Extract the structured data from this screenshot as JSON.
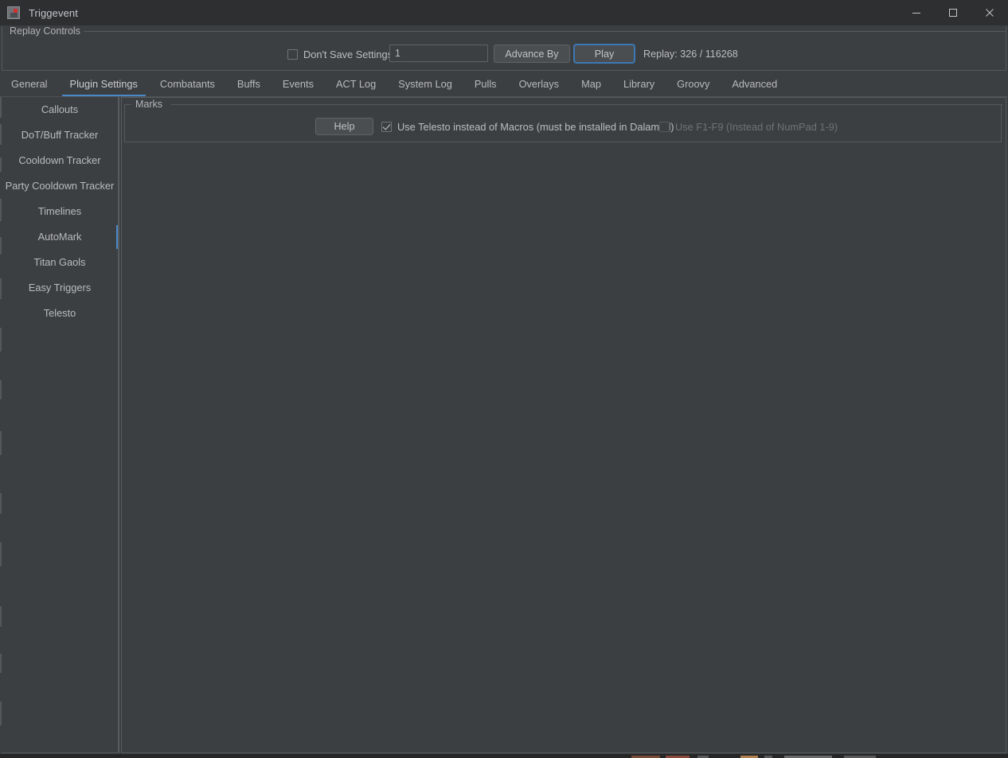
{
  "window": {
    "title": "Triggevent",
    "icon": "app-icon",
    "controls": {
      "minimize": "minimize-icon",
      "maximize": "maximize-icon",
      "close": "close-icon"
    }
  },
  "replay_controls": {
    "legend": "Replay Controls",
    "dont_save_label": "Don't Save Settings",
    "dont_save_checked": false,
    "advance_value": "1",
    "advance_placeholder": "",
    "advance_button": "Advance By",
    "play_button": "Play",
    "status": "Replay: 326 / 116268",
    "status_current": "326",
    "status_total": "116268"
  },
  "tabs": {
    "active": "Plugin Settings",
    "items": [
      {
        "label": "General"
      },
      {
        "label": "Plugin Settings"
      },
      {
        "label": "Combatants"
      },
      {
        "label": "Buffs"
      },
      {
        "label": "Events"
      },
      {
        "label": "ACT Log"
      },
      {
        "label": "System Log"
      },
      {
        "label": "Pulls"
      },
      {
        "label": "Overlays"
      },
      {
        "label": "Map"
      },
      {
        "label": "Library"
      },
      {
        "label": "Groovy"
      },
      {
        "label": "Advanced"
      }
    ]
  },
  "sidebar": {
    "selected": "AutoMark",
    "items": [
      {
        "label": "Callouts"
      },
      {
        "label": "DoT/Buff Tracker"
      },
      {
        "label": "Cooldown Tracker"
      },
      {
        "label": "Party Cooldown Tracker"
      },
      {
        "label": "Timelines"
      },
      {
        "label": "AutoMark"
      },
      {
        "label": "Titan Gaols"
      },
      {
        "label": "Easy Triggers"
      },
      {
        "label": "Telesto"
      }
    ]
  },
  "main": {
    "marks": {
      "legend": "Marks",
      "help_button": "Help",
      "telesto_checkbox": {
        "label": "Use Telesto instead of Macros (must be installed in Dalamud)",
        "checked": true,
        "disabled": false
      },
      "fkeys_checkbox": {
        "label": "Use F1-F9 (Instead of NumPad 1-9)",
        "checked": false,
        "disabled": true
      }
    }
  },
  "colors": {
    "accent": "#4a88c7",
    "panel_bg": "#3c3f41",
    "titlebar_bg": "#2d2f30",
    "border": "#555a5e",
    "text": "#b9bcbf",
    "text_disabled": "#6e7276"
  }
}
